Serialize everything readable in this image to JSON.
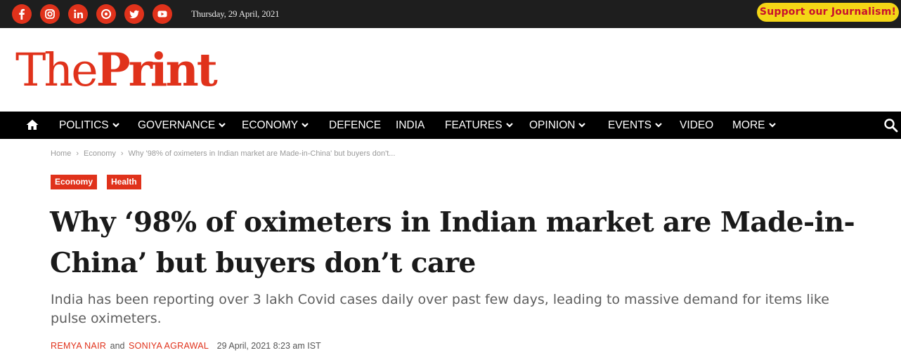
{
  "topbar": {
    "social_icons": [
      "facebook-icon",
      "instagram-icon",
      "linkedin-icon",
      "youtube-icon",
      "twitter-icon",
      "video-icon"
    ],
    "date": "Thursday, 29 April, 2021",
    "support_label": "Support our Journalism!"
  },
  "logo": {
    "part1": "The",
    "part2": "Print",
    "color": "#e0321b"
  },
  "nav": {
    "items": [
      {
        "label": "POLITICS",
        "dropdown": true
      },
      {
        "label": "GOVERNANCE",
        "dropdown": true
      },
      {
        "label": "ECONOMY",
        "dropdown": true
      },
      {
        "label": "DEFENCE",
        "dropdown": false
      },
      {
        "label": "INDIA",
        "dropdown": false
      },
      {
        "label": "FEATURES",
        "dropdown": true
      },
      {
        "label": "OPINION",
        "dropdown": true
      },
      {
        "label": "EVENTS",
        "dropdown": true
      },
      {
        "label": "VIDEO",
        "dropdown": false
      },
      {
        "label": "MORE",
        "dropdown": true
      }
    ]
  },
  "breadcrumb": {
    "home": "Home",
    "section": "Economy",
    "current": "Why '98% of oximeters in Indian market are Made-in-China' but buyers don't..."
  },
  "tags": [
    "Economy",
    "Health"
  ],
  "article": {
    "headline": "Why ‘98% of oximeters in Indian market are Made-in-China’ but buyers don’t care",
    "subhead": "India has been reporting over 3 lakh Covid cases daily over past few days, leading to massive demand for items like pulse oximeters.",
    "author1": "Remya Nair",
    "and": "and",
    "author2": "Soniya Agrawal",
    "date": "29 April, 2021 8:23 am IST"
  }
}
